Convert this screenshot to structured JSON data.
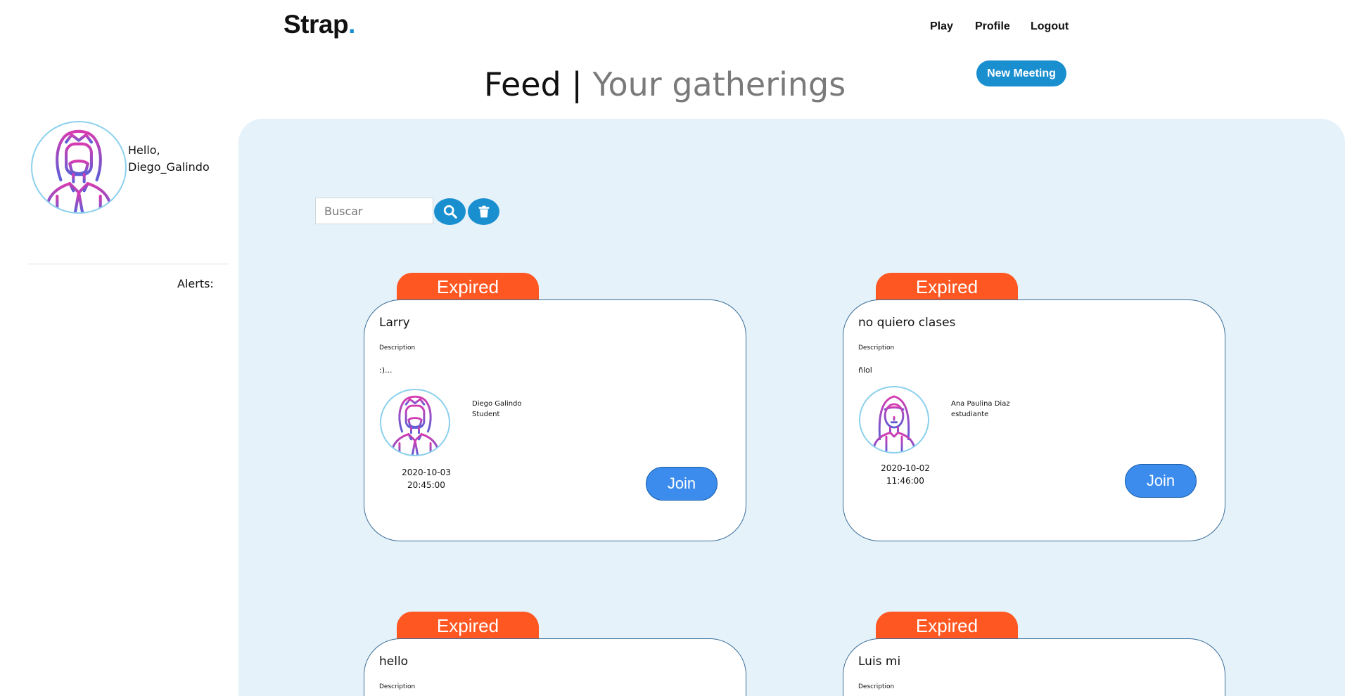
{
  "header": {
    "logo": "Strap",
    "logo_dot": ".",
    "nav": [
      "Play",
      "Profile",
      "Logout"
    ],
    "title_main": "Feed |",
    "title_sub": "Your gatherings",
    "new_meeting_label": "New Meeting"
  },
  "sidebar": {
    "greeting_hello": "Hello,",
    "username": "Diego_Galindo",
    "alerts_label": "Alerts:"
  },
  "search": {
    "placeholder": "Buscar",
    "search_icon": "search-icon",
    "clear_icon": "trash-icon"
  },
  "colors": {
    "accent": "#1a8fd0",
    "expired": "#ff5722",
    "join": "#3b8ced",
    "panel": "#e6f2fa"
  },
  "cards": [
    {
      "status": "Expired",
      "title": "Larry",
      "description_label": "Description",
      "description": ":)...",
      "owner_name": "Diego Galindo",
      "owner_role": "Student",
      "date": "2020-10-03",
      "time": "20:45:00",
      "join_label": "Join",
      "avatar_icon": "male-avatar-icon"
    },
    {
      "status": "Expired",
      "title": "no quiero clases",
      "description_label": "Description",
      "description": "ñlol",
      "owner_name": "Ana Paulina Diaz",
      "owner_role": "estudiante",
      "date": "2020-10-02",
      "time": "11:46:00",
      "join_label": "Join",
      "avatar_icon": "female-avatar-icon"
    },
    {
      "status": "Expired",
      "title": "hello",
      "description_label": "Description"
    },
    {
      "status": "Expired",
      "title": "Luis mi",
      "description_label": "Description"
    }
  ]
}
